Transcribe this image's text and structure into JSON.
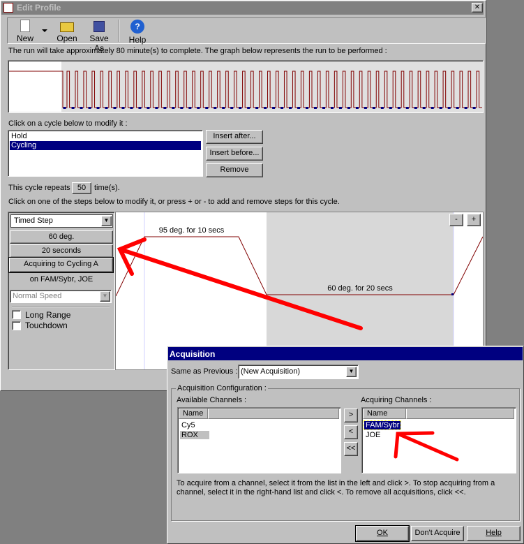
{
  "window": {
    "title": "Edit Profile",
    "close": "✕"
  },
  "toolbar": {
    "new": "New",
    "open": "Open",
    "save_as": "Save As",
    "help": "Help"
  },
  "run_info": "The run will take approximately 80 minute(s) to complete. The graph below represents the run to be performed :",
  "cycles": {
    "prompt": "Click on a cycle below to modify it :",
    "items": [
      "Hold",
      "Cycling"
    ],
    "selected": "Cycling",
    "insert_after": "Insert after...",
    "insert_before": "Insert before...",
    "remove": "Remove"
  },
  "repeat": {
    "prefix": "This cycle repeats",
    "value": "50",
    "suffix": "time(s)."
  },
  "steps_prompt": "Click on one of the steps below to modify it, or press + or - to add and remove steps for this cycle.",
  "step_panel": {
    "type": "Timed Step",
    "temp": "60 deg.",
    "time": "20 seconds",
    "acquire": "Acquiring to Cycling A",
    "channels": "on FAM/Sybr, JOE",
    "speed": "Normal Speed",
    "long_range": "Long Range",
    "touchdown": "Touchdown",
    "long_range_checked": false,
    "touchdown_checked": false
  },
  "step_graph": {
    "step1": "95 deg. for 10 secs",
    "step2": "60 deg. for 20 secs",
    "minus": "-",
    "plus": "+"
  },
  "colors": {
    "profile_line": "#800000",
    "acquire_mark": "#000080",
    "annotation_arrow": "#ff0000",
    "selection": "#000080"
  },
  "acquisition": {
    "title": "Acquisition",
    "same_as_previous_label": "Same as Previous :",
    "same_as_previous_value": "(New Acquisition)",
    "group_label": "Acquisition Configuration :",
    "available_label": "Available Channels :",
    "acquiring_label": "Acquiring Channels :",
    "column": "Name",
    "available": [
      "Cy5",
      "ROX"
    ],
    "acquiring": [
      "FAM/Sybr",
      "JOE"
    ],
    "add": ">",
    "remove": "<",
    "remove_all": "<<",
    "help_text": "To acquire from a channel, select it from the list in the left and click >. To stop acquiring from a channel, select it in the right-hand list and click <. To remove all acquisitions, click <<.",
    "ok": "OK",
    "dont_acquire": "Don't Acquire",
    "help": "Help"
  }
}
